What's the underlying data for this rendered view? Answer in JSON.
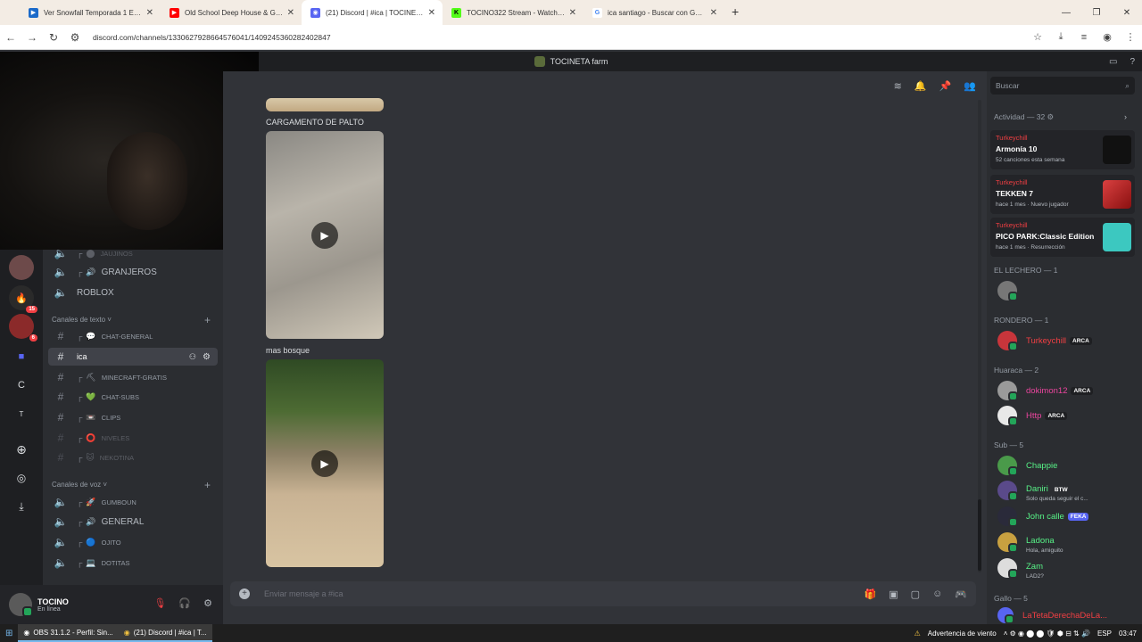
{
  "browser": {
    "tabs": [
      {
        "title": "Ver Snowfall Temporada 1 Episo",
        "fav_color": "#1b6ac9",
        "fav_char": "▶"
      },
      {
        "title": "Old School Deep House & Gara",
        "fav_color": "#ff0000",
        "fav_char": "▶"
      },
      {
        "title": "(21) Discord | #ica | TOCINETA F",
        "fav_color": "#5865f2",
        "fav_char": "◉"
      },
      {
        "title": "TOCINO322 Stream - Watch Live",
        "fav_color": "#53fc18",
        "fav_char": "K"
      },
      {
        "title": "ica santiago - Buscar con Goog",
        "fav_color": "#ffffff",
        "fav_char": "G"
      }
    ],
    "url": "discord.com/channels/1330627928664576041/1409245360282402847"
  },
  "discord": {
    "server_name": "TOCINETA farm",
    "voice_top": [
      {
        "name": "JAUJINOS",
        "emoji": "⬤"
      },
      {
        "name": "GRANJEROS",
        "emoji": "🔊"
      },
      {
        "name": "ROBLOX",
        "emoji": ""
      }
    ],
    "text_category": "Canales de texto",
    "text_channels": [
      {
        "name": "CHAT-GENERAL",
        "emoji": "💬"
      },
      {
        "name": "ica",
        "emoji": ""
      },
      {
        "name": "MINECRAFT-GRATIS",
        "emoji": "⛏"
      },
      {
        "name": "CHAT-SUBS",
        "emoji": "💚"
      },
      {
        "name": "CLIPS",
        "emoji": "📼"
      },
      {
        "name": "NIVELES",
        "emoji": "⭕"
      },
      {
        "name": "NEKOTINA",
        "emoji": "🐱"
      }
    ],
    "voice_category": "Canales de voz",
    "voice_channels": [
      {
        "name": "GUMBOUN",
        "emoji": "🚀"
      },
      {
        "name": "GENERAL",
        "emoji": "🔊"
      },
      {
        "name": "OJITO",
        "emoji": "🔵"
      },
      {
        "name": "DOTITAS",
        "emoji": "💻"
      }
    ],
    "server_badges": [
      "15",
      "6"
    ],
    "server_letters": [
      "C",
      "T"
    ],
    "user": {
      "name": "TOCINO",
      "status": "En línea"
    },
    "messages": [
      {
        "caption": "CARGAMENTO DE PALTO"
      },
      {
        "caption": "mas bosque"
      }
    ],
    "composer_placeholder": "Enviar mensaje a #ica",
    "search_placeholder": "Buscar",
    "activity_header": "Actividad — 32",
    "activities": [
      {
        "user": "Turkeychill",
        "game": "Armonía 10",
        "meta": "52 canciones esta semana"
      },
      {
        "user": "Turkeychill",
        "game": "TEKKEN 7",
        "meta": "hace 1 mes · Nuevo jugador"
      },
      {
        "user": "Turkeychill",
        "game": "PICO PARK:Classic Edition",
        "meta": "hace 1 mes · Resurrección"
      }
    ],
    "groups": [
      {
        "header": "EL LECHERO — 1",
        "members": [
          {
            "name": "",
            "color": "#949ba4",
            "tag": "",
            "sub": ""
          }
        ]
      },
      {
        "header": "RONDERO — 1",
        "members": [
          {
            "name": "Turkeychill",
            "color": "#f23f43",
            "tag": "ARCA",
            "sub": ""
          }
        ]
      },
      {
        "header": "Huaraca — 2",
        "members": [
          {
            "name": "dokimon12",
            "color": "#eb459e",
            "tag": "ARCA",
            "sub": ""
          },
          {
            "name": "Http",
            "color": "#eb459e",
            "tag": "ARCA",
            "sub": ""
          }
        ]
      },
      {
        "header": "Sub — 5",
        "members": [
          {
            "name": "Chappie",
            "color": "#57f287",
            "tag": "",
            "sub": ""
          },
          {
            "name": "Daniri",
            "color": "#57f287",
            "tag": "BTW",
            "sub": "Solo queda seguir el c..."
          },
          {
            "name": "John calle",
            "color": "#57f287",
            "tag": "FEKA",
            "sub": ""
          },
          {
            "name": "Ladona",
            "color": "#57f287",
            "tag": "",
            "sub": "Hola, amiguito"
          },
          {
            "name": "Zam",
            "color": "#57f287",
            "tag": "",
            "sub": "LAD2?"
          }
        ]
      },
      {
        "header": "Gallo — 5",
        "members": [
          {
            "name": "LaTetaDerechaDeLa...",
            "color": "#f23f43",
            "tag": "",
            "sub": ""
          }
        ]
      }
    ]
  },
  "taskbar": {
    "apps": [
      "OBS 31.1.2 - Perfil: Sin...",
      "(21) Discord | #ica | T..."
    ],
    "weather": "Advertencia de viento",
    "lang": "ESP",
    "time": "03:47"
  }
}
